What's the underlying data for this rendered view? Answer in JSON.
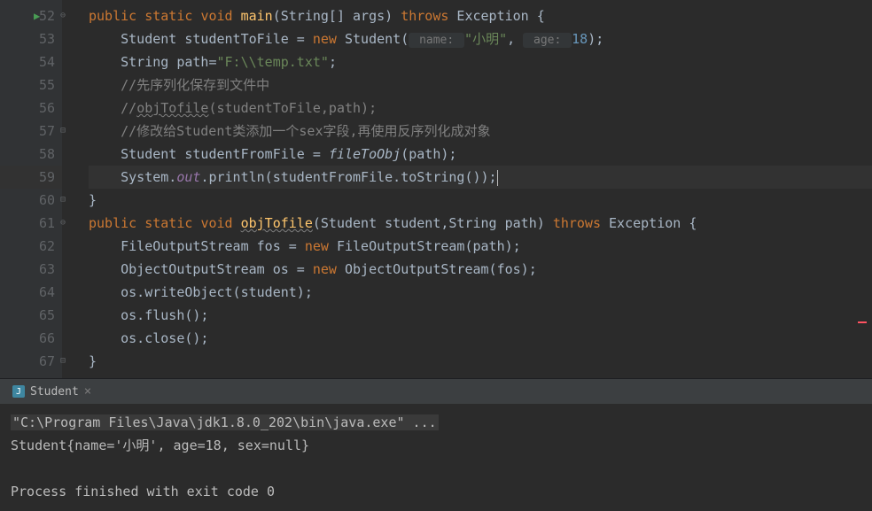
{
  "gutter": {
    "start": 52,
    "end": 67
  },
  "code": {
    "l52": {
      "kw1": "public",
      "kw2": "static",
      "kw3": "void",
      "name": "main",
      "args": "(String[] args) ",
      "throws": "throws",
      "exc": " Exception {"
    },
    "l53": {
      "pre": "    Student studentToFile = ",
      "new": "new",
      "ctor": " Student(",
      "hint1": " name: ",
      "str": "\"小明\"",
      "sep": ", ",
      "hint2": " age: ",
      "num": "18",
      "end": ");"
    },
    "l54": {
      "pre": "    String path=",
      "str": "\"F:\\\\temp.txt\"",
      "end": ";"
    },
    "l55": "    //先序列化保存到文件中",
    "l56": {
      "pre": "    //",
      "u": "objTofile",
      "rest": "(studentToFile,path);"
    },
    "l57": "    //修改给Student类添加一个sex字段,再使用反序列化成对象",
    "l58": {
      "pre": "    Student studentFromFile = ",
      "call": "fileToObj",
      "end": "(path);"
    },
    "l59": {
      "pre": "    System.",
      "out": "out",
      "mid": ".println(studentFromFile.toString());"
    },
    "l60": "}",
    "l61": {
      "kw1": "public",
      "kw2": "static",
      "kw3": "void",
      "name": "objTofile",
      "args": "(Student student,String path) ",
      "throws": "throws",
      "exc": " Exception {"
    },
    "l62": {
      "pre": "    FileOutputStream fos = ",
      "new": "new",
      "end": " FileOutputStream(path);"
    },
    "l63": {
      "pre": "    ObjectOutputStream os = ",
      "new": "new",
      "end": " ObjectOutputStream(fos);"
    },
    "l64": "    os.writeObject(student);",
    "l65": "    os.flush();",
    "l66": "    os.close();",
    "l67": "}"
  },
  "console": {
    "tab_label": "Student",
    "cmd": "\"C:\\Program Files\\Java\\jdk1.8.0_202\\bin\\java.exe\" ...",
    "out1": "Student{name='小明', age=18, sex=null}",
    "blank": "",
    "out2": "Process finished with exit code 0"
  }
}
